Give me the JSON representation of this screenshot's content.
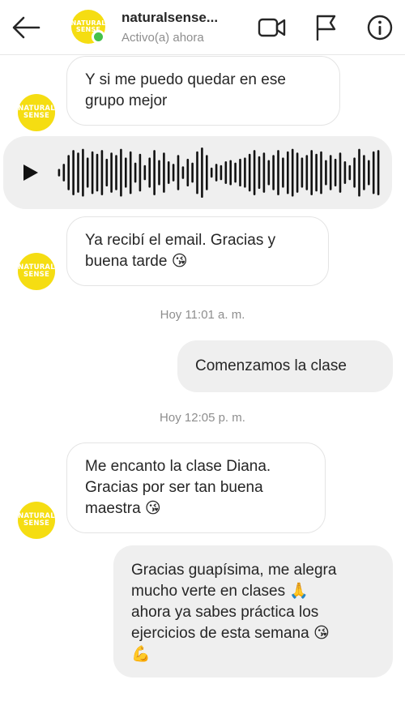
{
  "header": {
    "username": "naturalsense...",
    "status": "Activo(a) ahora",
    "avatar_lines": [
      "NATURAL",
      "SENSE"
    ],
    "icons": [
      "back-arrow-icon",
      "video-call-icon",
      "flag-icon",
      "info-icon"
    ]
  },
  "contact_logo": {
    "line1": "NATURAL",
    "line2": "SENSE",
    "color": "#f5dd12"
  },
  "messages": [
    {
      "type": "incoming",
      "text_lines": [
        "Y si me puedo quedar en ese",
        "grupo mejor"
      ]
    },
    {
      "type": "voice",
      "play_icon": "play-icon",
      "waveform_levels": [
        0.15,
        0.35,
        0.7,
        0.9,
        0.8,
        0.95,
        0.6,
        0.85,
        0.75,
        0.9,
        0.55,
        0.8,
        0.7,
        0.95,
        0.6,
        0.85,
        0.4,
        0.75,
        0.3,
        0.6,
        0.9,
        0.5,
        0.8,
        0.45,
        0.35,
        0.7,
        0.25,
        0.55,
        0.4,
        0.85,
        1.0,
        0.7,
        0.2,
        0.35,
        0.3,
        0.45,
        0.5,
        0.4,
        0.55,
        0.6,
        0.75,
        0.9,
        0.65,
        0.8,
        0.5,
        0.7,
        0.9,
        0.6,
        0.85,
        0.95,
        0.8,
        0.6,
        0.7,
        0.9,
        0.75,
        0.85,
        0.5,
        0.7,
        0.55,
        0.8,
        0.45,
        0.3,
        0.6,
        0.95,
        0.7,
        0.5,
        0.85,
        0.9
      ]
    },
    {
      "type": "incoming",
      "text_lines": [
        "Ya recibí el email. Gracias y",
        "buena tarde 😘"
      ]
    },
    {
      "type": "timestamp",
      "text": "Hoy 11:01 a. m."
    },
    {
      "type": "outgoing",
      "text_lines": [
        "Comenzamos la clase"
      ]
    },
    {
      "type": "timestamp",
      "text": "Hoy 12:05 p. m."
    },
    {
      "type": "incoming",
      "text_lines": [
        "Me encanto la clase Diana.",
        "Gracias por ser tan buena",
        "maestra 😘"
      ]
    },
    {
      "type": "outgoing",
      "text_lines": [
        "Gracias guapísima, me alegra",
        "mucho verte en clases 🙏",
        "ahora ya sabes práctica los",
        "ejercicios de esta semana 😘",
        "💪"
      ]
    }
  ]
}
